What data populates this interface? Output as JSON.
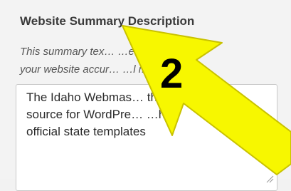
{
  "field": {
    "label": "Website Summary Description",
    "help_text": "This summary tex… …ease\nyour website accur… …l media.",
    "value": "The Idaho Webmas… the\nsource for WordPre… …he\nofficial state templates"
  },
  "annotation": {
    "number": "2",
    "arrow_color": "#f7f700",
    "arrow_outline": "#c9c200"
  },
  "icons": {
    "resize": "resize-handle-icon",
    "arrow": "pointer-arrow-icon"
  }
}
